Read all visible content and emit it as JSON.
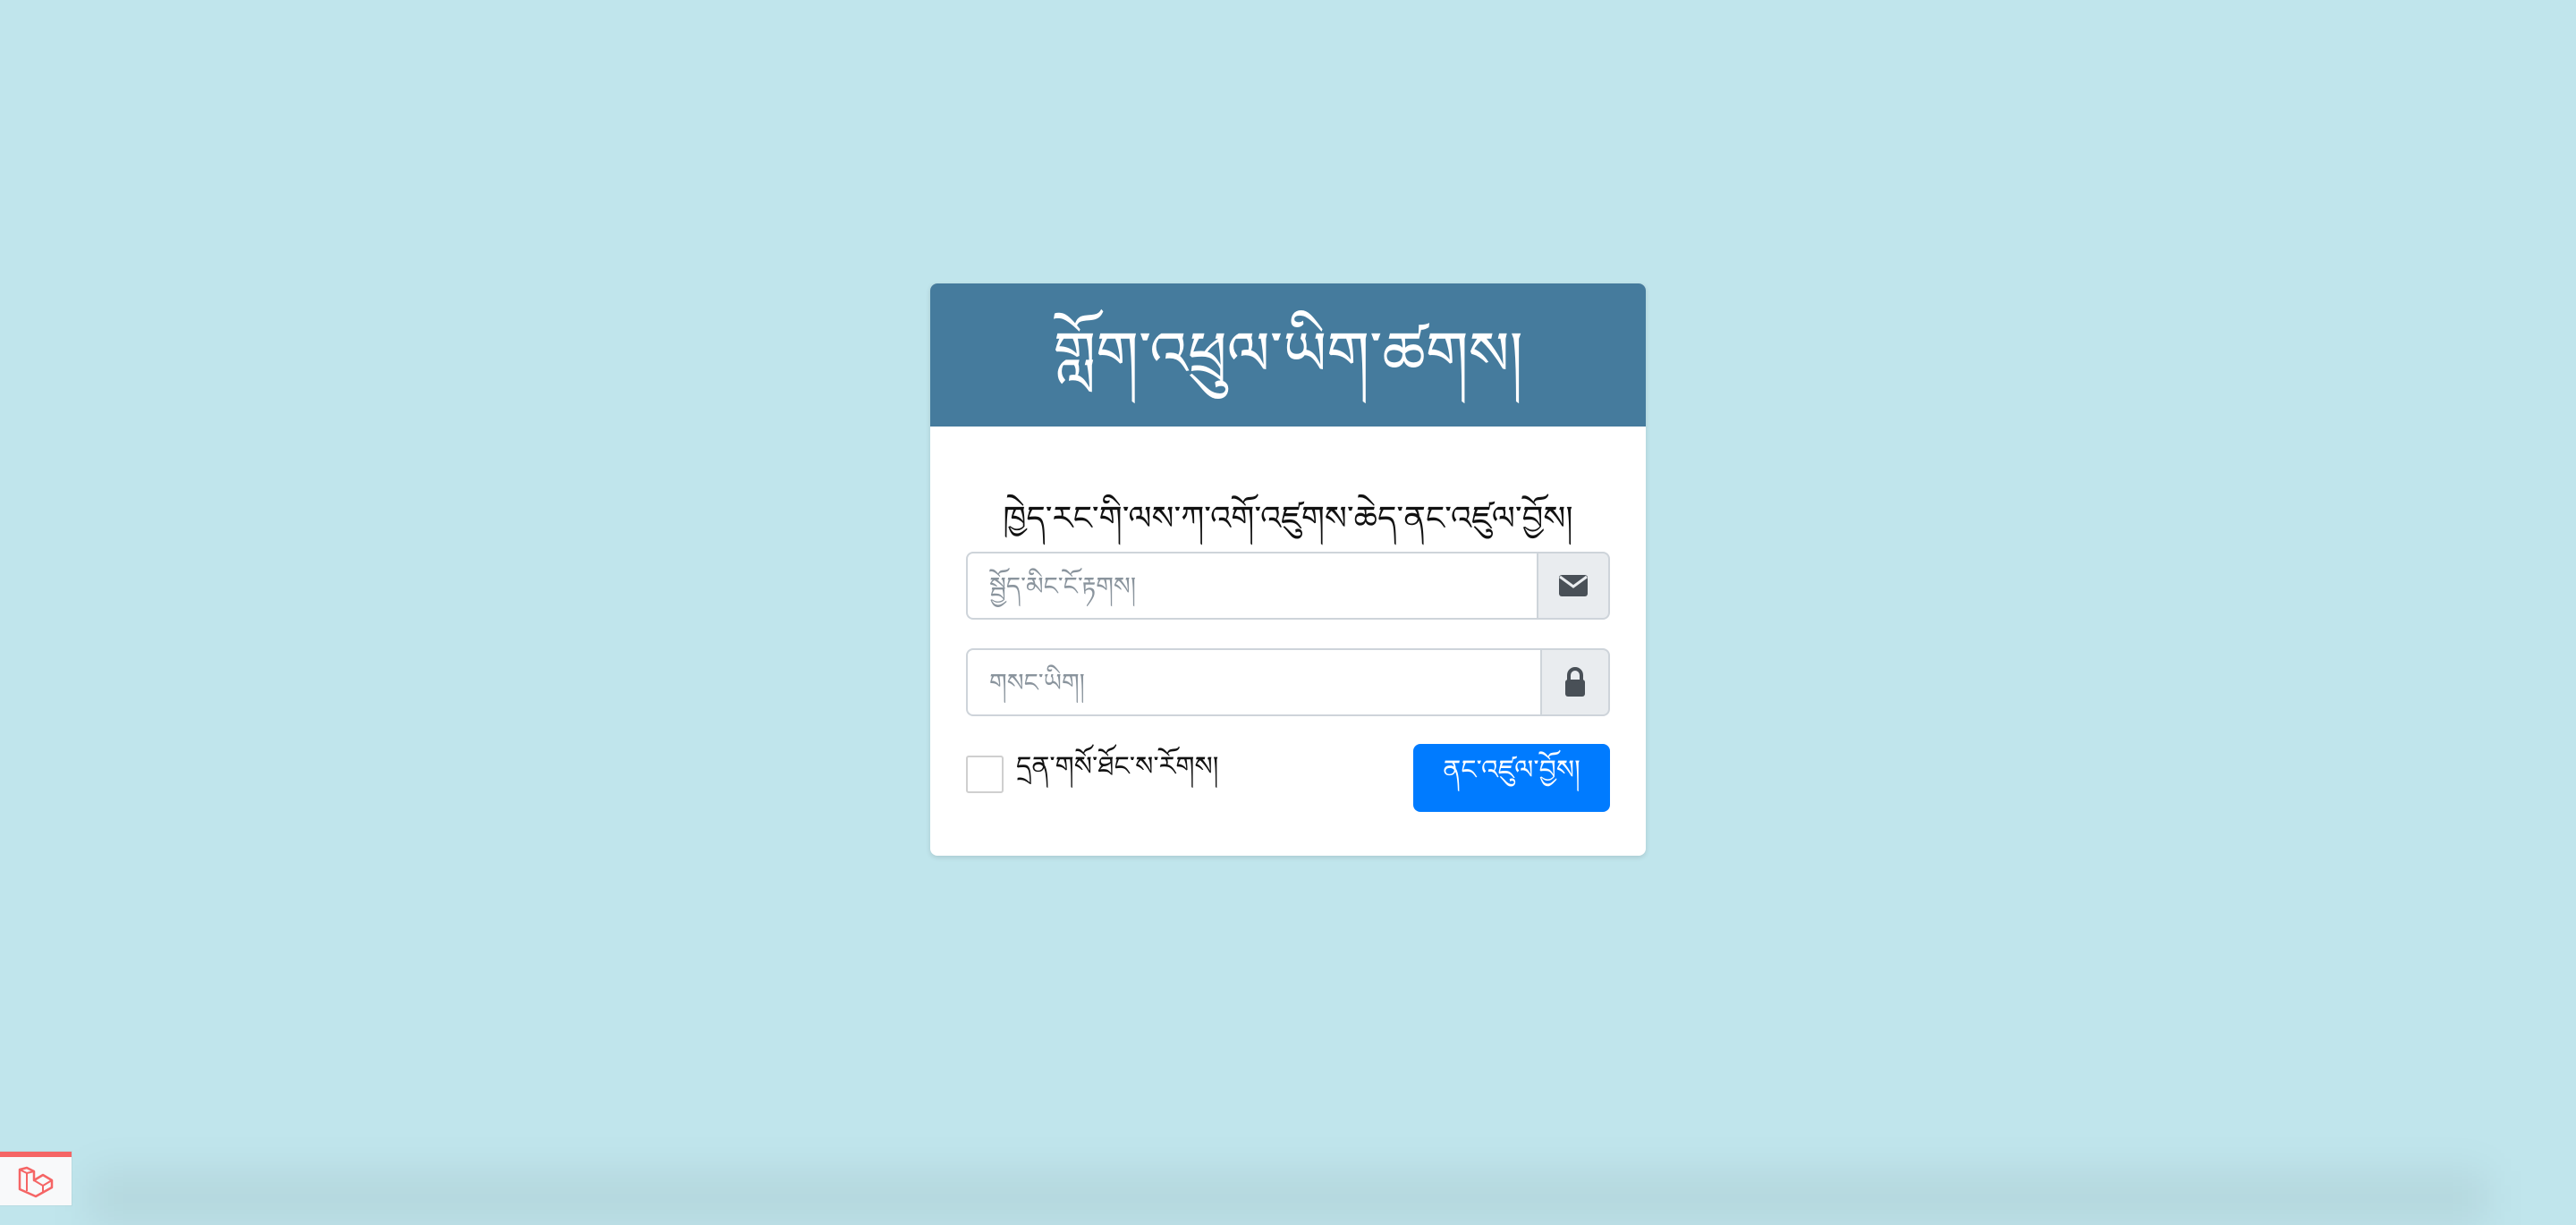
{
  "window": {
    "background": "#c0e5ec"
  },
  "login": {
    "title": "གློག་འཕྲུལ་ཡིག་ཚགས།",
    "subtitle": "ཁྱེད་རང་གི་ལས་ཀ་འགོ་འཛུགས་ཆེད་ནང་འཛུལ་བྱོས།",
    "email_placeholder": "སྦྱོད་མིང་ངོ་རྟགས།",
    "password_placeholder": "གསང་ཡིག།",
    "remember_label": "དྲན་གསོ་ཐོང་ས་རོགས།",
    "submit_label": "ནང་འཛུལ་བྱོས།",
    "header_color": "#457b9d",
    "button_color": "#007bff"
  },
  "icons": {
    "email": "envelope-icon",
    "password": "lock-icon",
    "corner": "laravel-logo-icon"
  }
}
